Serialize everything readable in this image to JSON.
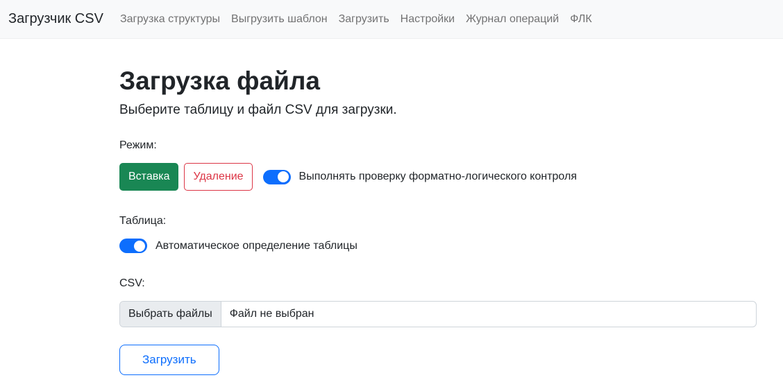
{
  "navbar": {
    "brand": "Загрузчик CSV",
    "items": [
      {
        "label": "Загрузка структуры"
      },
      {
        "label": "Выгрузить шаблон"
      },
      {
        "label": "Загрузить"
      },
      {
        "label": "Настройки"
      },
      {
        "label": "Журнал операций"
      },
      {
        "label": "ФЛК"
      }
    ]
  },
  "page": {
    "title": "Загрузка файла",
    "subtitle": "Выберите таблицу и файл CSV для загрузки."
  },
  "mode": {
    "label": "Режим:",
    "insert_button": "Вставка",
    "delete_button": "Удаление",
    "flc_toggle": {
      "label": "Выполнять проверку форматно-логического контроля",
      "checked": "true"
    }
  },
  "table": {
    "label": "Таблица:",
    "auto_toggle": {
      "label": "Автоматическое определение таблицы",
      "checked": "true"
    }
  },
  "csv": {
    "label": "CSV:",
    "file_button": "Выбрать файлы",
    "file_status": "Файл не выбран"
  },
  "actions": {
    "upload_button": "Загрузить"
  },
  "colors": {
    "success": "#198754",
    "danger": "#dc3545",
    "primary": "#0d6efd",
    "navbar_bg": "#f8f9fa",
    "text": "#212529",
    "file_button_bg": "#e9ecef",
    "input_border": "#ced4da"
  }
}
